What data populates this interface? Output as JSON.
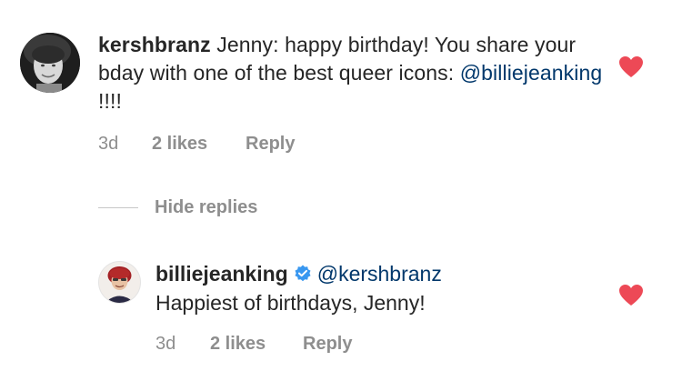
{
  "comment": {
    "username": "kershbranz",
    "text_before_mention": "Jenny: happy birthday! You share your bday with one of the best queer icons: ",
    "mention": "@billiejeanking",
    "text_after_mention": " !!!!",
    "age": "3d",
    "likes": "2 likes",
    "reply_label": "Reply",
    "liked": true,
    "avatar_icon": "profile-photo-icon"
  },
  "replies_toggle": {
    "label": "Hide replies"
  },
  "reply": {
    "username": "billiejeanking",
    "verified": true,
    "mention": "@kershbranz",
    "text": "Happiest of birthdays, Jenny!",
    "age": "3d",
    "likes": "2 likes",
    "reply_label": "Reply",
    "liked": true,
    "avatar_icon": "profile-photo-icon"
  },
  "colors": {
    "heart": "#ed4956",
    "mention": "#00376b",
    "meta": "#8e8e8e",
    "verified": "#3897f0",
    "text": "#262626"
  }
}
